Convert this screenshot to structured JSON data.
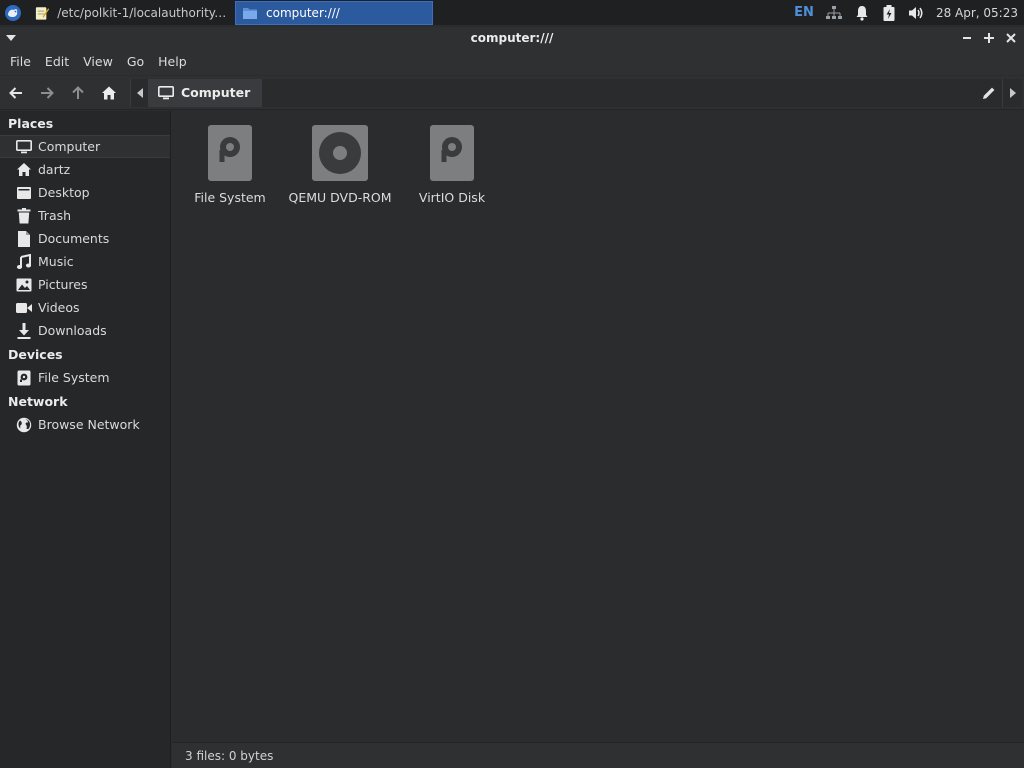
{
  "taskbar": {
    "tasks": [
      {
        "label": "/etc/polkit-1/localauthority.c...",
        "icon": "text-editor-icon",
        "active": false
      },
      {
        "label": "computer:///",
        "icon": "folder-icon",
        "active": true
      }
    ],
    "tray": {
      "language": "EN",
      "clock": "28 Apr, 05:23"
    }
  },
  "window": {
    "title": "computer:///"
  },
  "menubar": {
    "items": [
      "File",
      "Edit",
      "View",
      "Go",
      "Help"
    ]
  },
  "toolbar": {
    "path_segment": "Computer"
  },
  "sidebar": {
    "places_header": "Places",
    "places": [
      {
        "label": "Computer",
        "icon": "computer-icon",
        "selected": true
      },
      {
        "label": "dartz",
        "icon": "home-icon"
      },
      {
        "label": "Desktop",
        "icon": "desktop-icon"
      },
      {
        "label": "Trash",
        "icon": "trash-icon"
      },
      {
        "label": "Documents",
        "icon": "document-icon"
      },
      {
        "label": "Music",
        "icon": "music-icon"
      },
      {
        "label": "Pictures",
        "icon": "pictures-icon"
      },
      {
        "label": "Videos",
        "icon": "video-icon"
      },
      {
        "label": "Downloads",
        "icon": "download-icon"
      }
    ],
    "devices_header": "Devices",
    "devices": [
      {
        "label": "File System",
        "icon": "drive-icon"
      }
    ],
    "network_header": "Network",
    "network": [
      {
        "label": "Browse Network",
        "icon": "globe-icon"
      }
    ]
  },
  "files": [
    {
      "label": "File System",
      "icon": "harddisk-icon"
    },
    {
      "label": "QEMU DVD-ROM",
      "icon": "optical-drive-icon"
    },
    {
      "label": "VirtIO Disk",
      "icon": "harddisk-icon"
    }
  ],
  "statusbar": {
    "text": "3 files: 0 bytes"
  },
  "colors": {
    "accent": "#2c5a9e",
    "background": "#2b2c2e",
    "sidebar": "#262729"
  }
}
